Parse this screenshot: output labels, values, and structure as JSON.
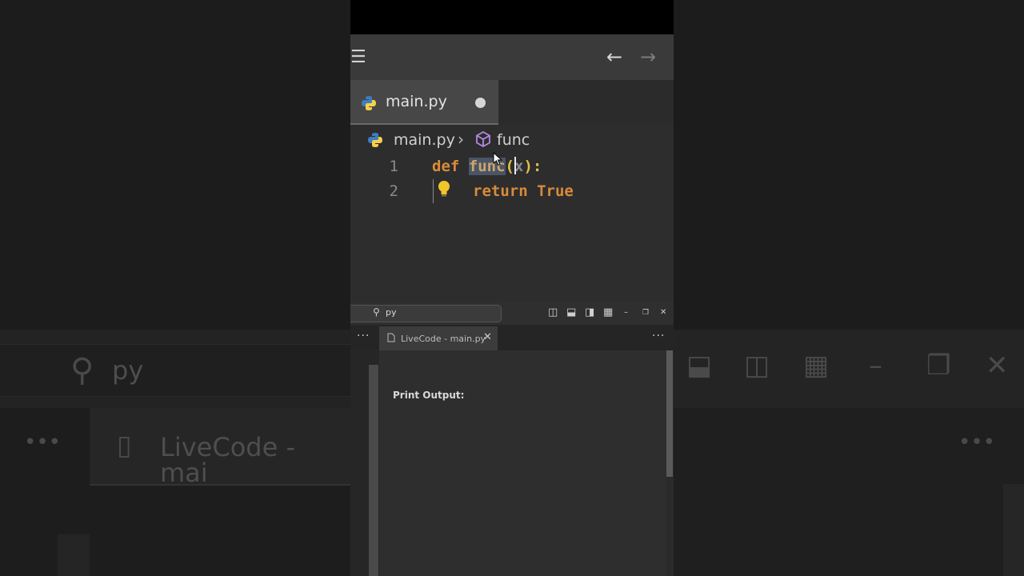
{
  "titlebar": {
    "menu_icon": "hamburger-menu-icon",
    "back_icon": "arrow-left-icon",
    "forward_icon": "arrow-right-icon"
  },
  "tab": {
    "label": "main.py",
    "dirty_indicator": "●",
    "icon": "python-icon"
  },
  "breadcrumb": {
    "file": "main.py",
    "separator": "›",
    "symbol": "func",
    "symbol_icon": "cube-icon"
  },
  "editor": {
    "line_numbers": [
      "1",
      "2"
    ],
    "line1": {
      "keyword": "def",
      "function": "func",
      "open_paren": "(",
      "param": "x",
      "close": "):"
    },
    "line2": {
      "keyword": "return",
      "value": "True"
    }
  },
  "panel": {
    "search_text": "py",
    "live_tab_label": "LiveCode - main.py",
    "more_label": "···",
    "print_output_label": "Print Output:"
  },
  "background": {
    "search_text": "py",
    "tab_text": "LiveCode - mai"
  },
  "colors": {
    "keyword": "#d98b3a",
    "selection": "#4a5566",
    "bracket": "#e0c04a"
  }
}
